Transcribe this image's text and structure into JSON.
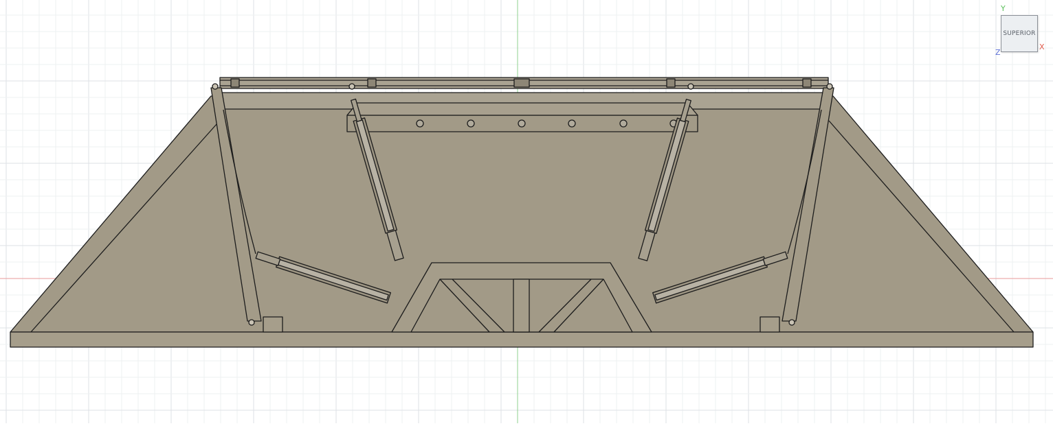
{
  "viewcube": {
    "face_label": "SUPERIOR",
    "axis_x": "X",
    "axis_y": "Y",
    "axis_z": "Z"
  },
  "colors": {
    "background": "#ffffff",
    "grid_minor": "#eef0f2",
    "grid_major": "#dde1e5",
    "axis_x_line": "#e88f8f",
    "axis_y_line": "#8fd08f",
    "model_fill": "#a29a87",
    "model_fill_light": "#a9a291",
    "model_edge": "#1c1c1c"
  }
}
